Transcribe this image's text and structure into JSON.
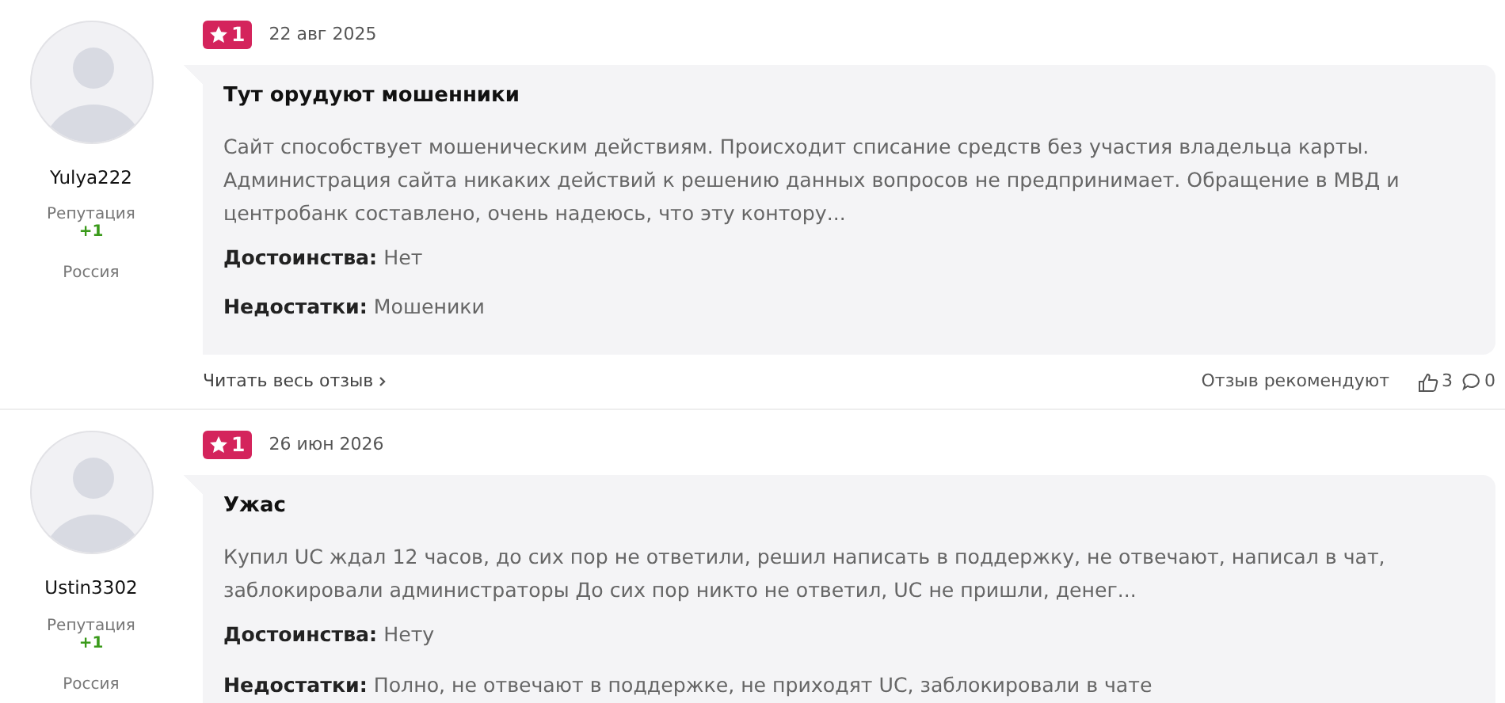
{
  "reviews": [
    {
      "author": {
        "name": "Yulya222",
        "reputation_label": "Репутация",
        "reputation": "+1",
        "country": "Россия"
      },
      "rating": "1",
      "date": "22 авг 2025",
      "title": "Тут орудуют мошенники",
      "text": "Сайт способствует мошеническим действиям. Происходит списание средств без участия владельца карты. Администрация сайта никаких действий к решению данных вопросов не предпринимает. Обращение в МВД и центробанк составлено, очень надеюсь, что эту контору...",
      "pros": "**Достоинства:** Нет",
      "cons": "**Недостатки:** Мошеники",
      "footer": {
        "read_more": "Читать весь отзыв",
        "recommend_label": "Отзыв рекомендуют",
        "likes": "3",
        "comments": "0"
      }
    },
    {
      "author": {
        "name": "Ustin3302",
        "reputation_label": "Репутация",
        "reputation": "+1",
        "country": "Россия"
      },
      "rating": "1",
      "date": "26 июн 2026",
      "title": "Ужас",
      "text": "Купил UC ждал 12 часов, до сих пор не ответили, решил написать в поддержку, не отвечают, написал в чат, заблокировали администраторы До сих пор никто не ответил, UC не пришли, денег...",
      "pros": "**Достоинства:** Нету",
      "cons": "**Недостатки:** Полно, не отвечают в поддержке, не приходят UC, заблокировали в чате"
    }
  ]
}
